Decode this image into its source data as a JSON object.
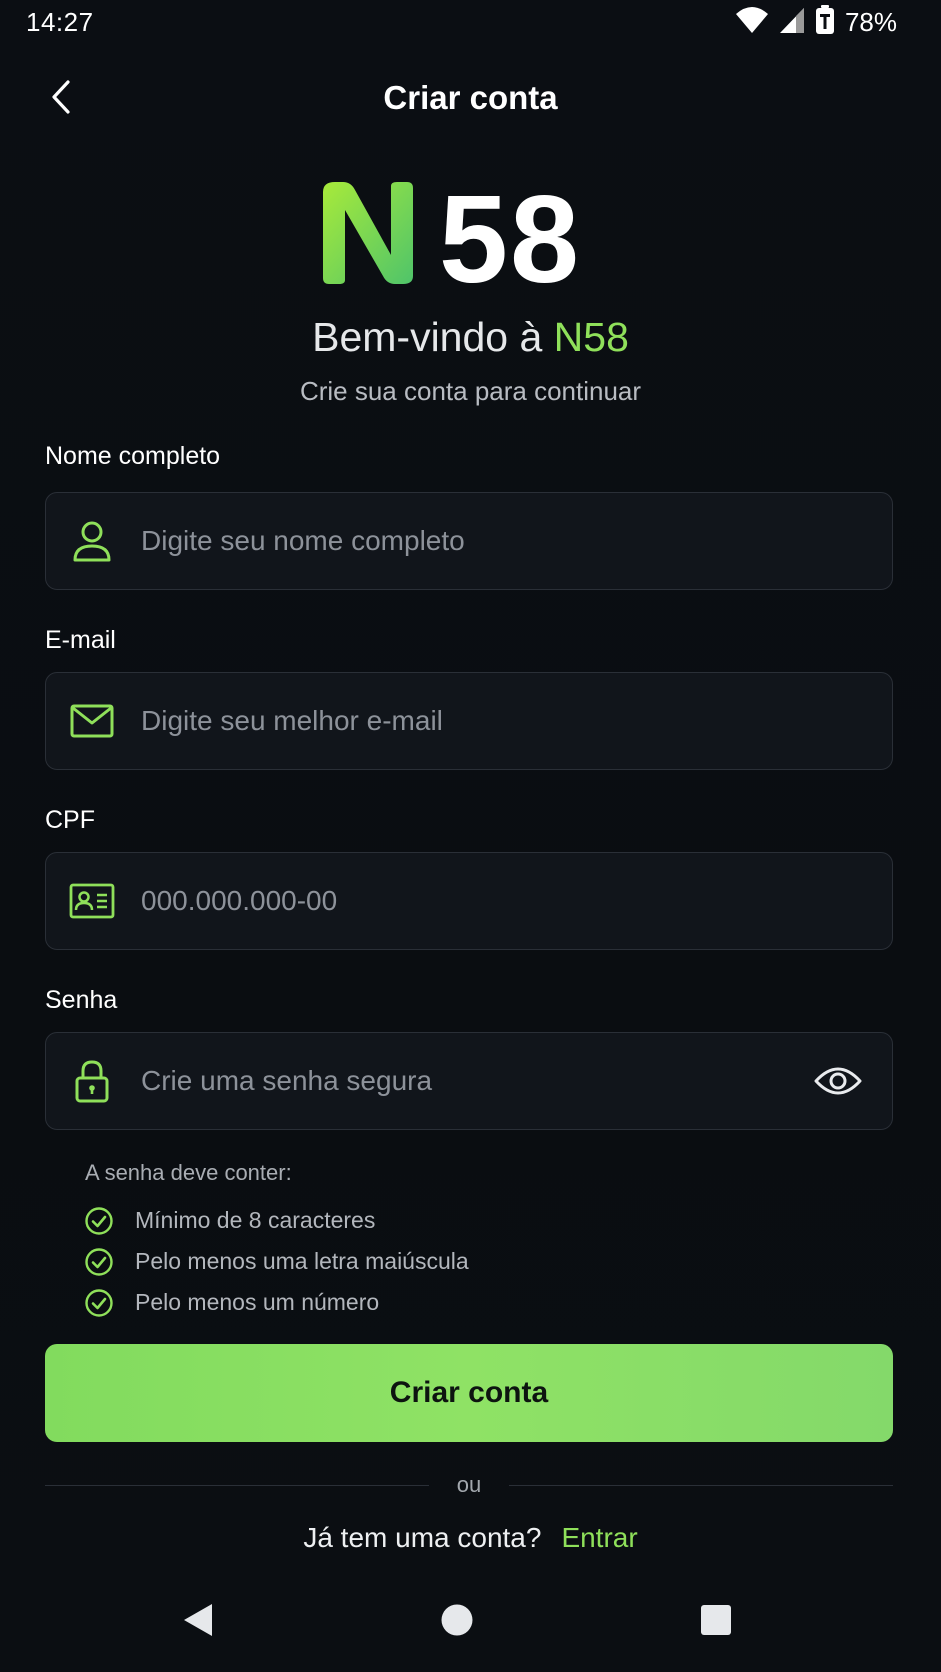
{
  "status_bar": {
    "time": "14:27",
    "battery": "78%",
    "icons": [
      "wifi-icon",
      "signal-icon",
      "battery-icon"
    ]
  },
  "header": {
    "title": "Criar conta",
    "back_icon": "chevron-left-icon"
  },
  "logo": {
    "letter": "N",
    "number": "58"
  },
  "welcome": {
    "prefix": "Bem-vindo à ",
    "brand": "N58",
    "subtitle": "Crie sua conta para continuar"
  },
  "form": {
    "name": {
      "label": "Nome completo",
      "placeholder": "Digite seu nome completo",
      "value": "",
      "icon": "user-icon"
    },
    "email": {
      "label": "E-mail",
      "placeholder": "Digite seu melhor e-mail",
      "value": "",
      "icon": "mail-icon"
    },
    "cpf": {
      "label": "CPF",
      "placeholder": "000.000.000-00",
      "value": "",
      "icon": "id-card-icon"
    },
    "password": {
      "label": "Senha",
      "placeholder": "Crie uma senha segura",
      "value": "",
      "icon": "lock-icon",
      "toggle_icon": "eye-icon"
    }
  },
  "password_requirements": {
    "title": "A senha deve conter:",
    "items": [
      "Mínimo de 8 caracteres",
      "Pelo menos uma letra maiúscula",
      "Pelo menos um número"
    ]
  },
  "actions": {
    "submit_label": "Criar conta",
    "divider_text": "ou",
    "login_prompt": "Já tem uma conta?",
    "login_link": "Entrar"
  },
  "colors": {
    "accent": "#8fe05a",
    "background": "#0a0d12",
    "field_bg": "#11151b",
    "field_border": "#2a2f37"
  },
  "nav_bar": {
    "icons": [
      "back-triangle-icon",
      "home-circle-icon",
      "recents-square-icon"
    ]
  }
}
